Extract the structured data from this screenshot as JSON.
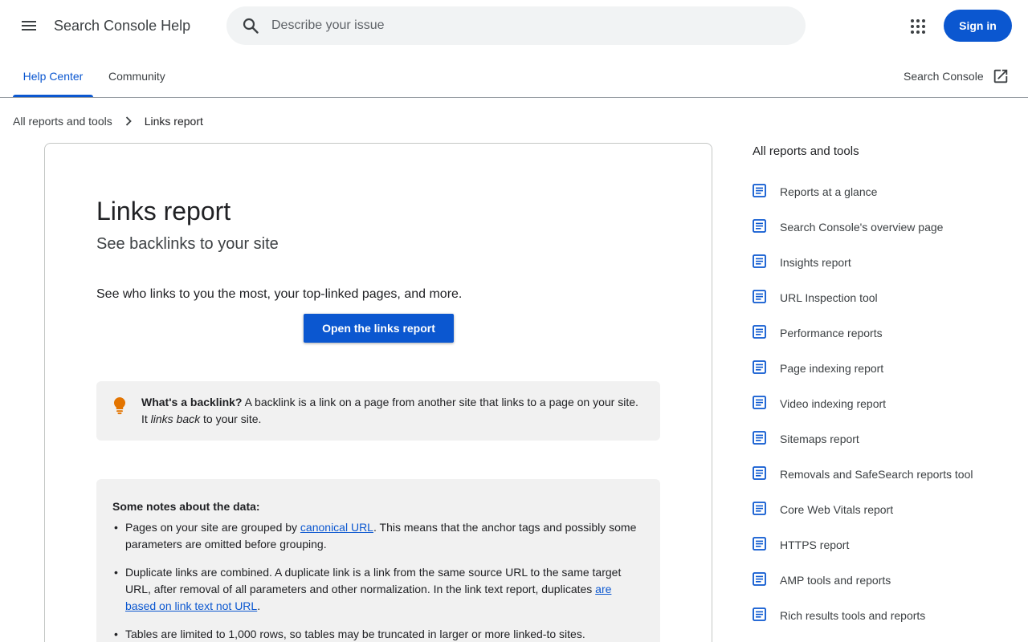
{
  "header": {
    "product_name": "Search Console Help",
    "search_placeholder": "Describe your issue",
    "signin_label": "Sign in"
  },
  "tabs": {
    "help_center": "Help Center",
    "community": "Community",
    "external_link": "Search Console"
  },
  "breadcrumb": {
    "parent": "All reports and tools",
    "current": "Links report"
  },
  "article": {
    "title": "Links report",
    "subtitle": "See backlinks to your site",
    "intro": "See who links to you the most, your top-linked pages, and more.",
    "button_label": "Open the links report",
    "tip": {
      "bold": "What's a backlink?",
      "text_before": " A backlink is a link on a page from another site that links to a page on your site. It ",
      "italic": "links back",
      "text_after": " to your site."
    },
    "notes": {
      "heading": "Some notes about the data:",
      "item1_before": "Pages on your site are grouped by ",
      "item1_link": "canonical URL",
      "item1_after": ". This means that the anchor tags and possibly some parameters are omitted before grouping.",
      "item2_before": "Duplicate links are combined. A duplicate link is a link from the same source URL to the same target URL, after removal of all parameters and other normalization. In the link text report, duplicates ",
      "item2_link": "are based on link text not URL",
      "item2_after": ".",
      "item3": "Tables are limited to 1,000 rows, so tables may be truncated in larger or more linked-to sites."
    }
  },
  "sidebar": {
    "title": "All reports and tools",
    "items": [
      {
        "label": "Reports at a glance"
      },
      {
        "label": "Search Console's overview page"
      },
      {
        "label": "Insights report"
      },
      {
        "label": "URL Inspection tool"
      },
      {
        "label": "Performance reports"
      },
      {
        "label": "Page indexing report"
      },
      {
        "label": "Video indexing report"
      },
      {
        "label": "Sitemaps report"
      },
      {
        "label": "Removals and SafeSearch reports tool"
      },
      {
        "label": "Core Web Vitals report"
      },
      {
        "label": "HTTPS report"
      },
      {
        "label": "AMP tools and reports"
      },
      {
        "label": "Rich results tools and reports"
      }
    ]
  },
  "colors": {
    "accent": "#0b57d0",
    "tip_icon": "#e37400",
    "doc_icon": "#0b57d0"
  }
}
